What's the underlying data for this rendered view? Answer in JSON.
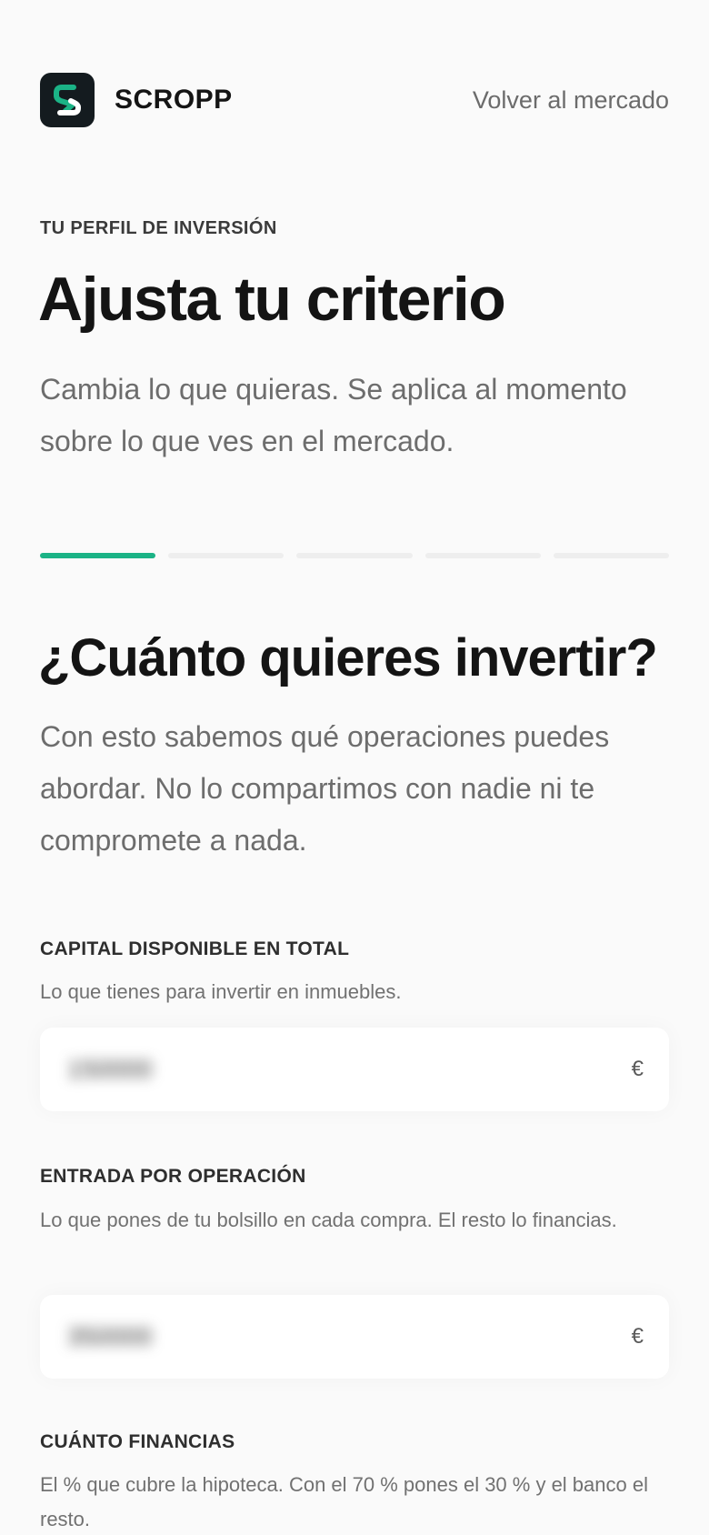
{
  "header": {
    "brand": "SCROPP",
    "back_link": "Volver al mercado"
  },
  "intro": {
    "eyebrow": "TU PERFIL DE INVERSIÓN",
    "title": "Ajusta tu criterio",
    "subtitle": "Cambia lo que quieras. Se aplica al momento sobre lo que ves en el mercado."
  },
  "progress": {
    "total_steps": 5,
    "current_step": 1,
    "accent_color": "#1bb386"
  },
  "step": {
    "question": "¿Cuánto quieres invertir?",
    "description": "Con esto sabemos qué operaciones puedes abordar. No lo compartimos con nadie ni te compromete a nada."
  },
  "fields": [
    {
      "label": "CAPITAL DISPONIBLE EN TOTAL",
      "help": "Lo que tienes para invertir en inmuebles.",
      "value": "150000",
      "unit": "€"
    },
    {
      "label": "ENTRADA POR OPERACIÓN",
      "help": "Lo que pones de tu bolsillo en cada compra. El resto lo financias.",
      "value": "350000",
      "unit": "€"
    },
    {
      "label": "CUÁNTO FINANCIAS",
      "help": "El % que cubre la hipoteca. Con el 70 % pones el 30 % y el banco el resto."
    }
  ],
  "icons": {
    "logo": "scropp-logo-icon"
  }
}
